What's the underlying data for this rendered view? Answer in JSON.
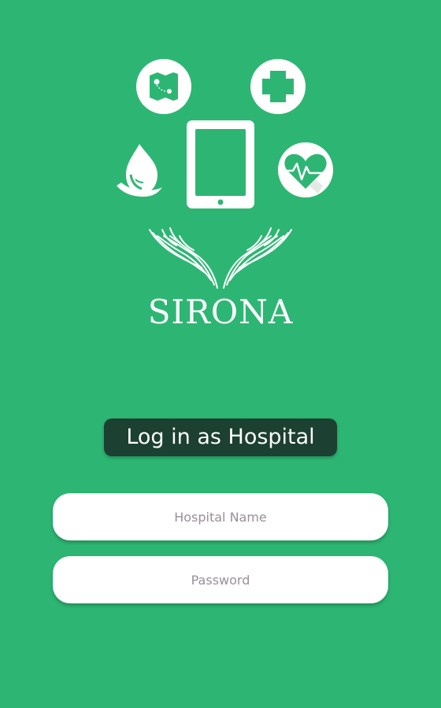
{
  "app": {
    "brand_name": "SIRONA",
    "icons": [
      "map-icon",
      "medical-cross-icon",
      "water-drop-hand-icon",
      "tablet-icon",
      "heartbeat-icon",
      "caring-hands-icon"
    ]
  },
  "login": {
    "title": "Log in as Hospital"
  },
  "form": {
    "hospital_name_placeholder": "Hospital Name",
    "password_placeholder": "Password",
    "hospital_name_value": "",
    "password_value": ""
  },
  "colors": {
    "background": "#2db673",
    "badge": "#1c4031",
    "icon": "#ffffff",
    "icon_green": "#2db673",
    "placeholder": "#9a8f99"
  }
}
